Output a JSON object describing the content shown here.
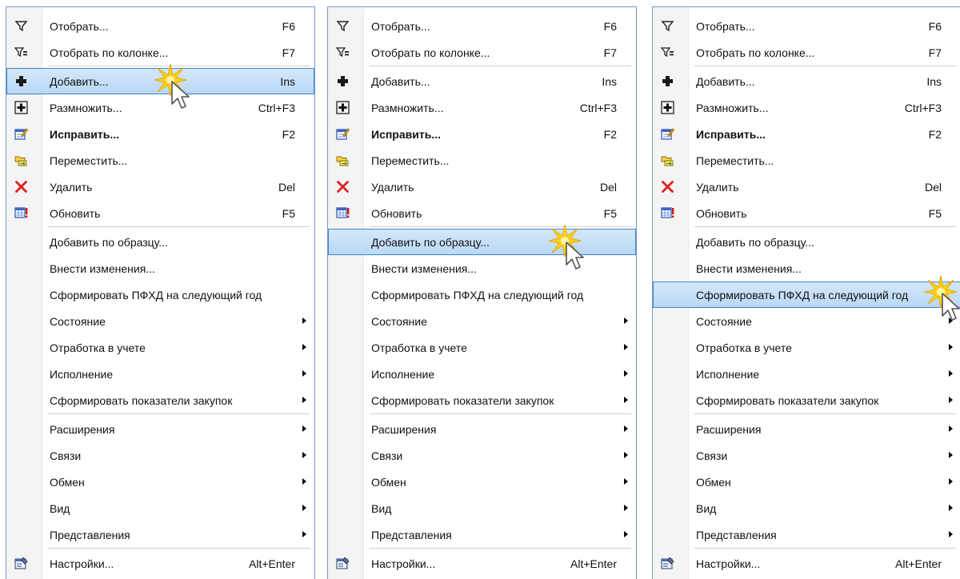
{
  "menus": [
    {
      "highlight": "add",
      "items": [
        {
          "t": "i",
          "id": "filter",
          "icon": "filter-icon",
          "label": "Отобрать...",
          "shortcut": "F6"
        },
        {
          "t": "i",
          "id": "filter-col",
          "icon": "filter-column-icon",
          "label": "Отобрать по колонке...",
          "shortcut": "F7"
        },
        {
          "t": "s"
        },
        {
          "t": "i",
          "id": "add",
          "icon": "add-icon",
          "label": "Добавить...",
          "shortcut": "Ins"
        },
        {
          "t": "i",
          "id": "multiply",
          "icon": "multiply-icon",
          "label": "Размножить...",
          "shortcut": "Ctrl+F3"
        },
        {
          "t": "i",
          "id": "edit",
          "icon": "edit-icon",
          "label": "Исправить...",
          "shortcut": "F2",
          "bold": true
        },
        {
          "t": "i",
          "id": "move",
          "icon": "move-icon",
          "label": "Переместить..."
        },
        {
          "t": "i",
          "id": "delete",
          "icon": "delete-icon",
          "label": "Удалить",
          "shortcut": "Del"
        },
        {
          "t": "i",
          "id": "refresh",
          "icon": "refresh-icon",
          "label": "Обновить",
          "shortcut": "F5"
        },
        {
          "t": "s"
        },
        {
          "t": "i",
          "id": "add-by-sample",
          "label": "Добавить по образцу..."
        },
        {
          "t": "i",
          "id": "make-changes",
          "label": "Внести изменения..."
        },
        {
          "t": "i",
          "id": "form-pfhd",
          "label": "Сформировать ПФХД на следующий год"
        },
        {
          "t": "i",
          "id": "state",
          "label": "Состояние",
          "sub": true
        },
        {
          "t": "i",
          "id": "accounting",
          "label": "Отработка в учете",
          "sub": true
        },
        {
          "t": "i",
          "id": "execution",
          "label": "Исполнение",
          "sub": true
        },
        {
          "t": "i",
          "id": "purchase-indicators",
          "label": "Сформировать показатели закупок",
          "sub": true
        },
        {
          "t": "s"
        },
        {
          "t": "i",
          "id": "extensions",
          "label": "Расширения",
          "sub": true
        },
        {
          "t": "i",
          "id": "links",
          "label": "Связи",
          "sub": true
        },
        {
          "t": "i",
          "id": "exchange",
          "label": "Обмен",
          "sub": true
        },
        {
          "t": "i",
          "id": "view",
          "label": "Вид",
          "sub": true
        },
        {
          "t": "i",
          "id": "views",
          "label": "Представления",
          "sub": true
        },
        {
          "t": "s"
        },
        {
          "t": "i",
          "id": "settings",
          "icon": "settings-icon",
          "label": "Настройки...",
          "shortcut": "Alt+Enter"
        }
      ]
    },
    {
      "highlight": "add-by-sample",
      "items": [
        {
          "t": "i",
          "id": "filter",
          "icon": "filter-icon",
          "label": "Отобрать...",
          "shortcut": "F6"
        },
        {
          "t": "i",
          "id": "filter-col",
          "icon": "filter-column-icon",
          "label": "Отобрать по колонке...",
          "shortcut": "F7"
        },
        {
          "t": "s"
        },
        {
          "t": "i",
          "id": "add",
          "icon": "add-icon",
          "label": "Добавить...",
          "shortcut": "Ins"
        },
        {
          "t": "i",
          "id": "multiply",
          "icon": "multiply-icon",
          "label": "Размножить...",
          "shortcut": "Ctrl+F3"
        },
        {
          "t": "i",
          "id": "edit",
          "icon": "edit-icon",
          "label": "Исправить...",
          "shortcut": "F2",
          "bold": true
        },
        {
          "t": "i",
          "id": "move",
          "icon": "move-icon",
          "label": "Переместить..."
        },
        {
          "t": "i",
          "id": "delete",
          "icon": "delete-icon",
          "label": "Удалить",
          "shortcut": "Del"
        },
        {
          "t": "i",
          "id": "refresh",
          "icon": "refresh-icon",
          "label": "Обновить",
          "shortcut": "F5"
        },
        {
          "t": "s"
        },
        {
          "t": "i",
          "id": "add-by-sample",
          "label": "Добавить по образцу..."
        },
        {
          "t": "i",
          "id": "make-changes",
          "label": "Внести изменения..."
        },
        {
          "t": "i",
          "id": "form-pfhd",
          "label": "Сформировать ПФХД на следующий год"
        },
        {
          "t": "i",
          "id": "state",
          "label": "Состояние",
          "sub": true
        },
        {
          "t": "i",
          "id": "accounting",
          "label": "Отработка в учете",
          "sub": true
        },
        {
          "t": "i",
          "id": "execution",
          "label": "Исполнение",
          "sub": true
        },
        {
          "t": "i",
          "id": "purchase-indicators",
          "label": "Сформировать показатели закупок",
          "sub": true
        },
        {
          "t": "s"
        },
        {
          "t": "i",
          "id": "extensions",
          "label": "Расширения",
          "sub": true
        },
        {
          "t": "i",
          "id": "links",
          "label": "Связи",
          "sub": true
        },
        {
          "t": "i",
          "id": "exchange",
          "label": "Обмен",
          "sub": true
        },
        {
          "t": "i",
          "id": "view",
          "label": "Вид",
          "sub": true
        },
        {
          "t": "i",
          "id": "views",
          "label": "Представления",
          "sub": true
        },
        {
          "t": "s"
        },
        {
          "t": "i",
          "id": "settings",
          "icon": "settings-icon",
          "label": "Настройки...",
          "shortcut": "Alt+Enter"
        }
      ]
    },
    {
      "highlight": "form-pfhd",
      "items": [
        {
          "t": "i",
          "id": "filter",
          "icon": "filter-icon",
          "label": "Отобрать...",
          "shortcut": "F6"
        },
        {
          "t": "i",
          "id": "filter-col",
          "icon": "filter-column-icon",
          "label": "Отобрать по колонке...",
          "shortcut": "F7"
        },
        {
          "t": "s"
        },
        {
          "t": "i",
          "id": "add",
          "icon": "add-icon",
          "label": "Добавить...",
          "shortcut": "Ins"
        },
        {
          "t": "i",
          "id": "multiply",
          "icon": "multiply-icon",
          "label": "Размножить...",
          "shortcut": "Ctrl+F3"
        },
        {
          "t": "i",
          "id": "edit",
          "icon": "edit-icon",
          "label": "Исправить...",
          "shortcut": "F2",
          "bold": true
        },
        {
          "t": "i",
          "id": "move",
          "icon": "move-icon",
          "label": "Переместить..."
        },
        {
          "t": "i",
          "id": "delete",
          "icon": "delete-icon",
          "label": "Удалить",
          "shortcut": "Del"
        },
        {
          "t": "i",
          "id": "refresh",
          "icon": "refresh-icon",
          "label": "Обновить",
          "shortcut": "F5"
        },
        {
          "t": "s"
        },
        {
          "t": "i",
          "id": "add-by-sample",
          "label": "Добавить по образцу..."
        },
        {
          "t": "i",
          "id": "make-changes",
          "label": "Внести изменения..."
        },
        {
          "t": "i",
          "id": "form-pfhd",
          "label": "Сформировать ПФХД на следующий год"
        },
        {
          "t": "i",
          "id": "state",
          "label": "Состояние",
          "sub": true
        },
        {
          "t": "i",
          "id": "accounting",
          "label": "Отработка в учете",
          "sub": true
        },
        {
          "t": "i",
          "id": "execution",
          "label": "Исполнение",
          "sub": true
        },
        {
          "t": "i",
          "id": "purchase-indicators",
          "label": "Сформировать показатели закупок",
          "sub": true
        },
        {
          "t": "s"
        },
        {
          "t": "i",
          "id": "extensions",
          "label": "Расширения",
          "sub": true
        },
        {
          "t": "i",
          "id": "links",
          "label": "Связи",
          "sub": true
        },
        {
          "t": "i",
          "id": "exchange",
          "label": "Обмен",
          "sub": true
        },
        {
          "t": "i",
          "id": "view",
          "label": "Вид",
          "sub": true
        },
        {
          "t": "i",
          "id": "views",
          "label": "Представления",
          "sub": true
        },
        {
          "t": "s"
        },
        {
          "t": "i",
          "id": "settings",
          "icon": "settings-icon",
          "label": "Настройки...",
          "shortcut": "Alt+Enter"
        }
      ]
    }
  ],
  "colors": {
    "highlight_top": "#d5e8fa",
    "highlight_bottom": "#b9d7f5",
    "highlight_border": "#3d86d0",
    "menu_border": "#7a9ac3",
    "delete_red": "#e02020"
  }
}
